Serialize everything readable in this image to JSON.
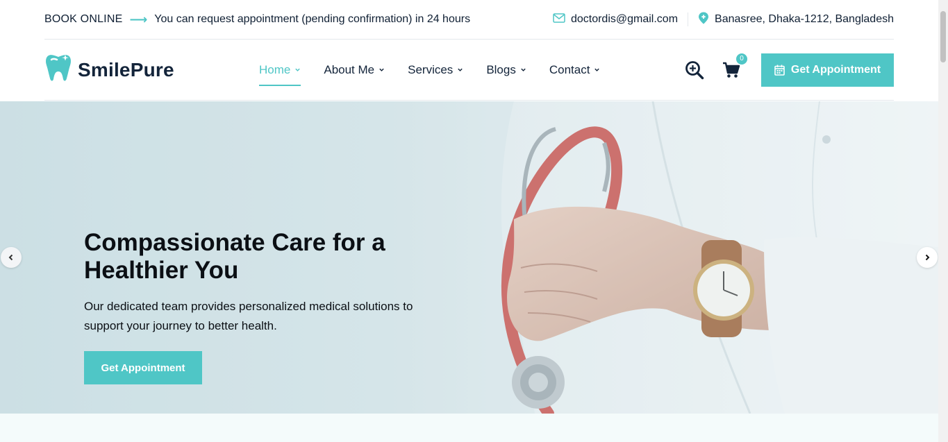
{
  "topbar": {
    "book_label": "BOOK ONLINE",
    "notice": "You can request appointment (pending confirmation) in 24 hours",
    "email": "doctordis@gmail.com",
    "address": "Banasree, Dhaka-1212, Bangladesh"
  },
  "header": {
    "logo_text": "SmilePure",
    "nav": [
      {
        "label": "Home",
        "active": true
      },
      {
        "label": "About Me",
        "active": false
      },
      {
        "label": "Services",
        "active": false
      },
      {
        "label": "Blogs",
        "active": false
      },
      {
        "label": "Contact",
        "active": false
      }
    ],
    "cart_count": "0",
    "appointment_label": "Get Appointment"
  },
  "hero": {
    "title": "Compassionate Care for a Healthier You",
    "subtitle": "Our dedicated team provides personalized medical solutions to support your journey to better health.",
    "button_label": "Get Appointment"
  },
  "colors": {
    "accent": "#4fc6c6",
    "dark": "#13243a"
  },
  "icons": [
    "arrow-right-icon",
    "mail-icon",
    "location-pin-icon",
    "tooth-logo-icon",
    "chevron-down-icon",
    "search-plus-icon",
    "cart-icon",
    "calendar-icon",
    "chevron-left-icon",
    "chevron-right-icon"
  ]
}
